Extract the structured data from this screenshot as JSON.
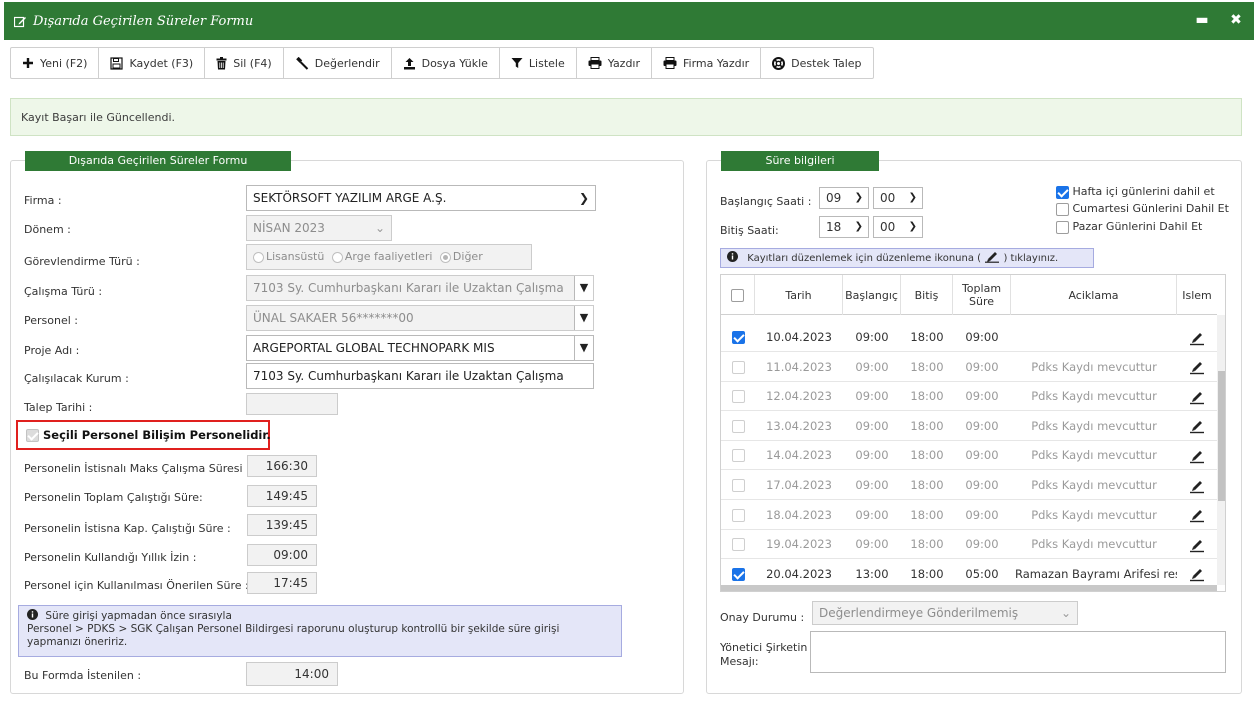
{
  "window": {
    "title": "Dışarıda Geçirilen Süreler Formu",
    "minimize_label": "▬",
    "close_label": "✖"
  },
  "toolbar": {
    "new_label": "Yeni (F2)",
    "save_label": "Kaydet (F3)",
    "delete_label": "Sil (F4)",
    "evaluate_label": "Değerlendir",
    "upload_label": "Dosya Yükle",
    "list_label": "Listele",
    "print_label": "Yazdır",
    "company_print_label": "Firma Yazdır",
    "support_label": "Destek Talep"
  },
  "alert": {
    "message": "Kayıt Başarı ile Güncellendi."
  },
  "form": {
    "panel_title": "Dışarıda Geçirilen Süreler Formu",
    "firma_label": "Firma :",
    "firma_value": "SEKTÖRSOFT YAZILIM ARGE A.Ş.",
    "donem_label": "Dönem :",
    "donem_value": "NİSAN 2023",
    "gorev_label": "Görevlendirme Türü :",
    "gorev_options": [
      "Lisansüstü",
      "Arge faaliyetleri",
      "Diğer"
    ],
    "calisma_turu_label": "Çalışma Türü :",
    "calisma_turu_value": "7103 Sy. Cumhurbaşkanı Kararı ile Uzaktan Çalışma",
    "personel_label": "Personel :",
    "personel_value": "ÜNAL SAKAER 56*******00",
    "proje_label": "Proje Adı :",
    "proje_value": "ARGEPORTAL GLOBAL TECHNOPARK MIS",
    "kurum_label": "Çalışılacak Kurum :",
    "kurum_value": "7103 Sy. Cumhurbaşkanı Kararı ile Uzaktan Çalışma",
    "talep_label": "Talep Tarihi :",
    "talep_value": "",
    "bilisim_label": "Seçili Personel Bilişim Personelidir.",
    "istisnali_label": "Personelin İstisnalı Maks Çalışma Süresi :",
    "istisnali_value": "166:30",
    "toplam_label": "Personelin Toplam Çalıştığı Süre:",
    "toplam_value": "149:45",
    "istisna_kap_label": "Personelin İstisna Kap. Çalıştığı Süre :",
    "istisna_kap_value": "139:45",
    "izin_label": "Personelin Kullandığı Yıllık İzin :",
    "izin_value": "09:00",
    "onerilen_label": "Personel için Kullanılması Önerilen Süre :",
    "onerilen_value": "17:45",
    "info_line1": "Süre girişi yapmadan önce sırasıyla",
    "info_line2": "Personel > PDKS > SGK Çalışan Personel Bildirgesi raporunu oluşturup kontrollü bir şekilde süre girişi",
    "info_line3": "yapmanızı öneririz.",
    "istenilen_label": "Bu Formda İstenilen :",
    "istenilen_value": "14:00"
  },
  "sure": {
    "panel_title": "Süre bilgileri",
    "baslangic_label": "Başlangıç Saati :",
    "baslangic_hour": "09",
    "baslangic_min": "00",
    "bitis_label": "Bitiş Saati:",
    "bitis_hour": "18",
    "bitis_min": "00",
    "hafta_ici_label": "Hafta içi günlerini dahil et",
    "cumartesi_label": "Cumartesi Günlerini Dahil Et",
    "pazar_label": "Pazar Günlerini Dahil Et",
    "info_before": "Kayıtları düzenlemek için düzenleme ikonuna (",
    "info_after": ") tıklayınız.",
    "columns": {
      "tarih": "Tarih",
      "baslangic": "Başlangıç",
      "bitis": "Bitiş",
      "toplam": "Toplam Süre",
      "aciklama": "Aciklama",
      "islem": "Islem"
    },
    "rows": [
      {
        "checked": true,
        "tarih": "10.04.2023",
        "baslangic": "09:00",
        "bitis": "18:00",
        "toplam": "09:00",
        "aciklama": ""
      },
      {
        "checked": false,
        "tarih": "11.04.2023",
        "baslangic": "09:00",
        "bitis": "18:00",
        "toplam": "09:00",
        "aciklama": "Pdks Kaydı mevcuttur"
      },
      {
        "checked": false,
        "tarih": "12.04.2023",
        "baslangic": "09:00",
        "bitis": "18:00",
        "toplam": "09:00",
        "aciklama": "Pdks Kaydı mevcuttur"
      },
      {
        "checked": false,
        "tarih": "13.04.2023",
        "baslangic": "09:00",
        "bitis": "18:00",
        "toplam": "09:00",
        "aciklama": "Pdks Kaydı mevcuttur"
      },
      {
        "checked": false,
        "tarih": "14.04.2023",
        "baslangic": "09:00",
        "bitis": "18:00",
        "toplam": "09:00",
        "aciklama": "Pdks Kaydı mevcuttur"
      },
      {
        "checked": false,
        "tarih": "17.04.2023",
        "baslangic": "09:00",
        "bitis": "18:00",
        "toplam": "09:00",
        "aciklama": "Pdks Kaydı mevcuttur"
      },
      {
        "checked": false,
        "tarih": "18.04.2023",
        "baslangic": "09:00",
        "bitis": "18:00",
        "toplam": "09:00",
        "aciklama": "Pdks Kaydı mevcuttur"
      },
      {
        "checked": false,
        "tarih": "19.04.2023",
        "baslangic": "09:00",
        "bitis": "18:00",
        "toplam": "09:00",
        "aciklama": "Pdks Kaydı mevcuttur"
      },
      {
        "checked": true,
        "tarih": "20.04.2023",
        "baslangic": "13:00",
        "bitis": "18:00",
        "toplam": "05:00",
        "aciklama": "Ramazan Bayramı Arifesi resmi"
      }
    ],
    "onay_label": "Onay Durumu :",
    "onay_value": "Değerlendirmeye Gönderilmemiş",
    "yonetici_label_1": "Yönetici Şirketin",
    "yonetici_label_2": "Mesajı:"
  },
  "colors": {
    "header_green": "#2f7a35",
    "success_bg": "#eef7e9",
    "info_bg": "#e4e6f8",
    "checkbox_blue": "#1a73e8",
    "highlight_red": "#e0201e"
  }
}
